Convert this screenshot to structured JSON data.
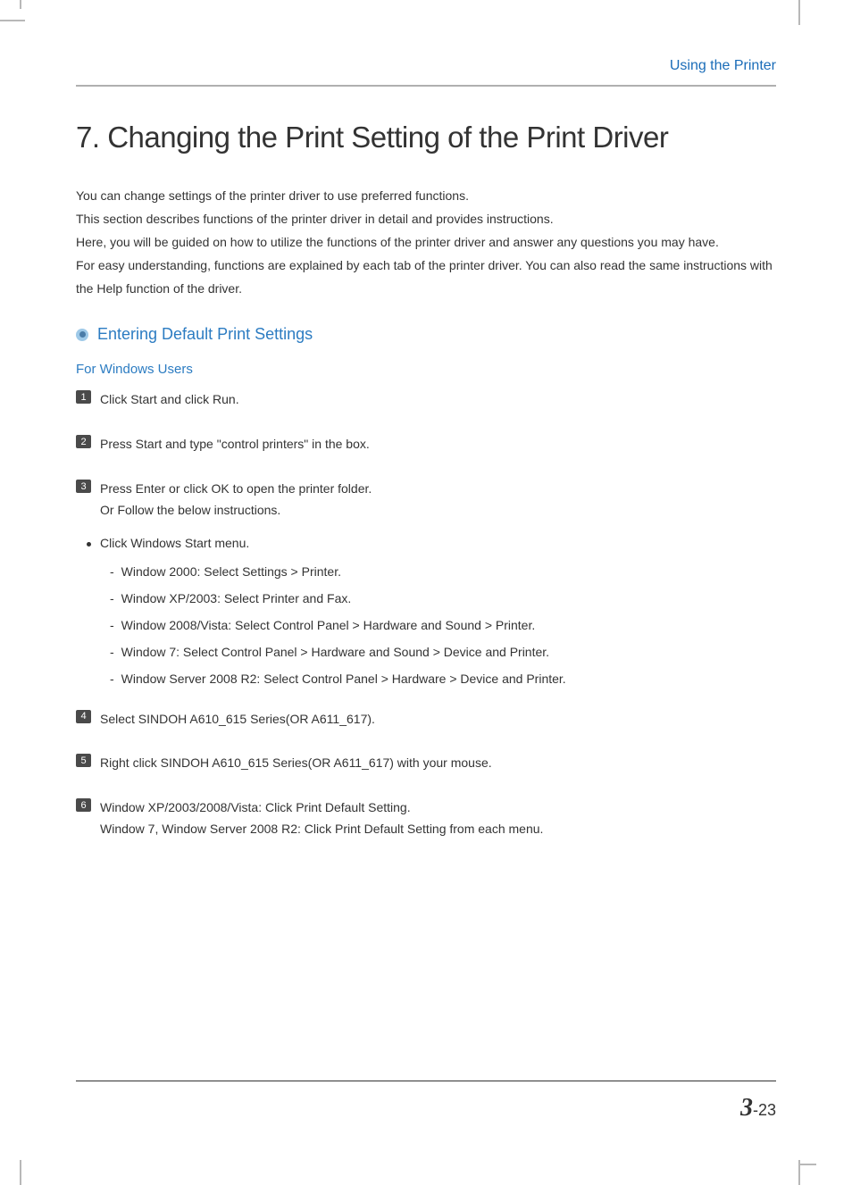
{
  "header": {
    "breadcrumb": "Using the Printer"
  },
  "main": {
    "heading": "7. Changing the Print Setting of the Print Driver",
    "intro": "You can change settings of the printer driver to use preferred functions.\nThis section describes functions of the printer driver in detail and provides instructions.\nHere, you will be guided on how to utilize the functions of the printer driver and answer any questions you may have.\nFor easy understanding, functions are explained by each tab of the printer driver. You can also read the same instructions with the Help function of the driver."
  },
  "section": {
    "title": "Entering Default Print Settings",
    "subsection": "For Windows Users"
  },
  "steps": {
    "s1": {
      "num": "1",
      "text": "Click Start and click Run."
    },
    "s2": {
      "num": "2",
      "text": "Press Start and type \"control printers\" in the box."
    },
    "s3": {
      "num": "3",
      "text": "Press Enter or click OK to open the printer folder.\nOr Follow the below instructions."
    },
    "s4": {
      "num": "4",
      "text": "Select SINDOH A610_615 Series(OR A611_617)."
    },
    "s5": {
      "num": "5",
      "text": "Right click SINDOH A610_615 Series(OR A611_617)  with your mouse."
    },
    "s6": {
      "num": "6",
      "text": "Window XP/2003/2008/Vista: Click Print Default Setting.\nWindow 7, Window Server 2008 R2: Click Print Default Setting from each menu."
    }
  },
  "bullet": {
    "text": "Click Windows Start menu."
  },
  "dashes": {
    "d1": "Window 2000: Select Settings > Printer.",
    "d2": "Window XP/2003: Select Printer and Fax.",
    "d3": "Window 2008/Vista: Select Control Panel > Hardware and Sound > Printer.",
    "d4": "Window 7: Select Control Panel > Hardware and Sound > Device and Printer.",
    "d5": "Window Server 2008 R2: Select Control Panel > Hardware > Device and Printer."
  },
  "footer": {
    "chapter": "3",
    "page": "-23"
  }
}
